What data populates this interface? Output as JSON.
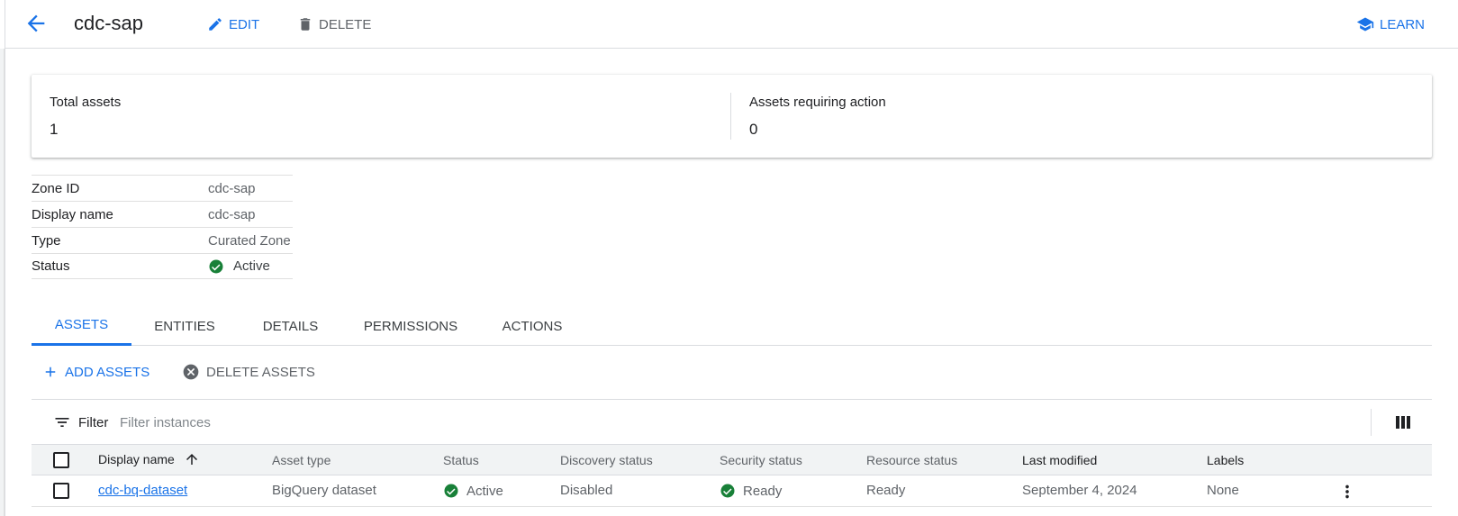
{
  "header": {
    "title": "cdc-sap",
    "edit_label": "EDIT",
    "delete_label": "DELETE",
    "learn_label": "LEARN"
  },
  "summary": {
    "total_assets_label": "Total assets",
    "total_assets_value": "1",
    "requiring_action_label": "Assets requiring action",
    "requiring_action_value": "0"
  },
  "properties": [
    {
      "key": "Zone ID",
      "value": "cdc-sap"
    },
    {
      "key": "Display name",
      "value": "cdc-sap"
    },
    {
      "key": "Type",
      "value": "Curated Zone"
    },
    {
      "key": "Status",
      "value": "Active"
    }
  ],
  "tabs": [
    {
      "label": "ASSETS",
      "active": true
    },
    {
      "label": "ENTITIES",
      "active": false
    },
    {
      "label": "DETAILS",
      "active": false
    },
    {
      "label": "PERMISSIONS",
      "active": false
    },
    {
      "label": "ACTIONS",
      "active": false
    }
  ],
  "actions": {
    "add_label": "ADD ASSETS",
    "delete_label": "DELETE ASSETS"
  },
  "filter": {
    "label": "Filter",
    "placeholder": "Filter instances"
  },
  "table": {
    "columns": [
      "Display name",
      "Asset type",
      "Status",
      "Discovery status",
      "Security status",
      "Resource status",
      "Last modified",
      "Labels"
    ],
    "rows": [
      {
        "display_name": "cdc-bq-dataset",
        "asset_type": "BigQuery dataset",
        "status": "Active",
        "discovery_status": "Disabled",
        "security_status": "Ready",
        "resource_status": "Ready",
        "last_modified": "September 4, 2024",
        "labels": "None"
      }
    ]
  },
  "colors": {
    "accent": "#1a73e8",
    "success": "#188038",
    "muted": "#5f6368"
  }
}
